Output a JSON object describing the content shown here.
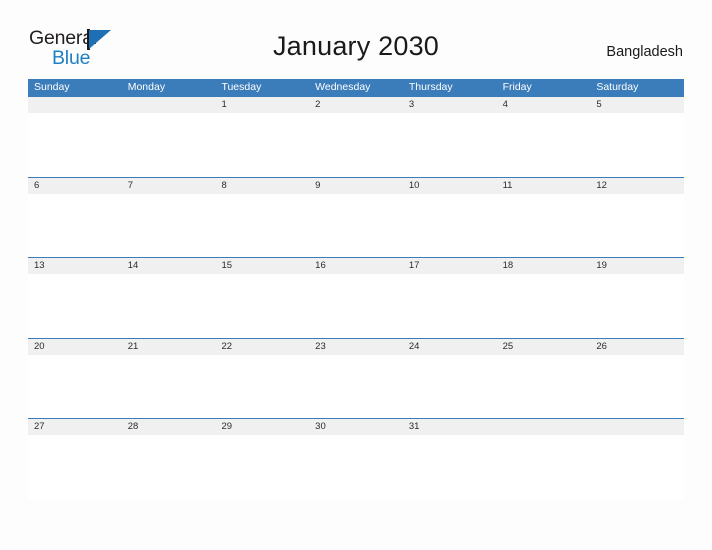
{
  "brand": {
    "name_part1": "General",
    "name_part2": "Blue",
    "logo_icon": "triangle-flag-icon",
    "accent_color": "#1f7fc4"
  },
  "header": {
    "title": "January 2030",
    "month": "January",
    "year": "2030",
    "country": "Bangladesh"
  },
  "calendar": {
    "header_bg_color": "#3b7cba",
    "date_band_color": "#f0f0f0",
    "grid_line_color": "#3b7cba",
    "weekdays": [
      "Sunday",
      "Monday",
      "Tuesday",
      "Wednesday",
      "Thursday",
      "Friday",
      "Saturday"
    ],
    "weeks": [
      [
        "",
        "",
        "1",
        "2",
        "3",
        "4",
        "5"
      ],
      [
        "6",
        "7",
        "8",
        "9",
        "10",
        "11",
        "12"
      ],
      [
        "13",
        "14",
        "15",
        "16",
        "17",
        "18",
        "19"
      ],
      [
        "20",
        "21",
        "22",
        "23",
        "24",
        "25",
        "26"
      ],
      [
        "27",
        "28",
        "29",
        "30",
        "31",
        "",
        ""
      ]
    ]
  }
}
